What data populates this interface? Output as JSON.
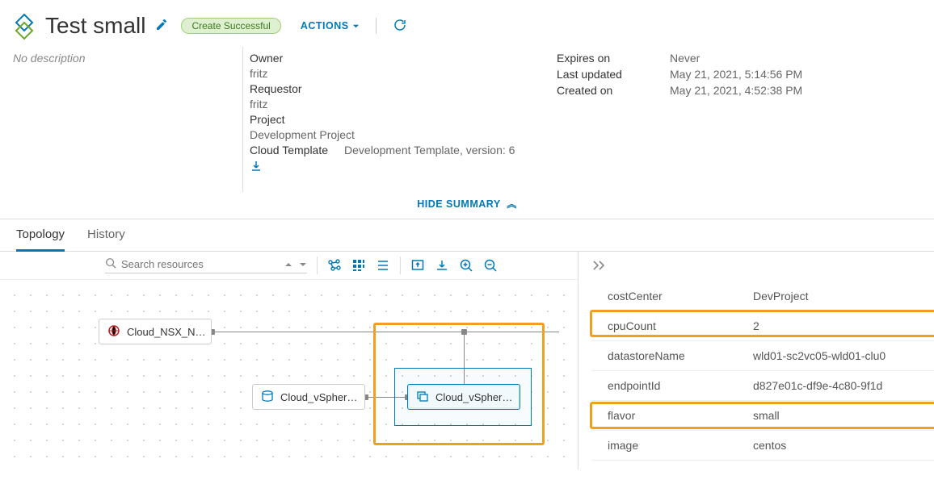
{
  "header": {
    "title": "Test small",
    "status": "Create Successful",
    "actions_label": "ACTIONS"
  },
  "summary": {
    "description": "No description",
    "owner_label": "Owner",
    "owner_value": "fritz",
    "requestor_label": "Requestor",
    "requestor_value": "fritz",
    "project_label": "Project",
    "project_value": "Development Project",
    "cloud_template_label": "Cloud Template",
    "cloud_template_value": "Development Template, version: 6",
    "expires_label": "Expires on",
    "expires_value": "Never",
    "last_updated_label": "Last updated",
    "last_updated_value": "May 21, 2021, 5:14:56 PM",
    "created_label": "Created on",
    "created_value": "May 21, 2021, 4:52:38 PM",
    "hide_label": "HIDE SUMMARY"
  },
  "tabs": {
    "topology": "Topology",
    "history": "History"
  },
  "toolbar": {
    "search_placeholder": "Search resources"
  },
  "nodes": {
    "nsx": "Cloud_NSX_N…",
    "disk": "Cloud_vSpher…",
    "machine": "Cloud_vSpher…"
  },
  "props": {
    "costCenter": {
      "k": "costCenter",
      "v": "DevProject"
    },
    "cpuCount": {
      "k": "cpuCount",
      "v": "2"
    },
    "datastoreName": {
      "k": "datastoreName",
      "v": "wld01-sc2vc05-wld01-clu0"
    },
    "endpointId": {
      "k": "endpointId",
      "v": "d827e01c-df9e-4c80-9f1d"
    },
    "flavor": {
      "k": "flavor",
      "v": "small"
    },
    "image": {
      "k": "image",
      "v": "centos"
    }
  }
}
